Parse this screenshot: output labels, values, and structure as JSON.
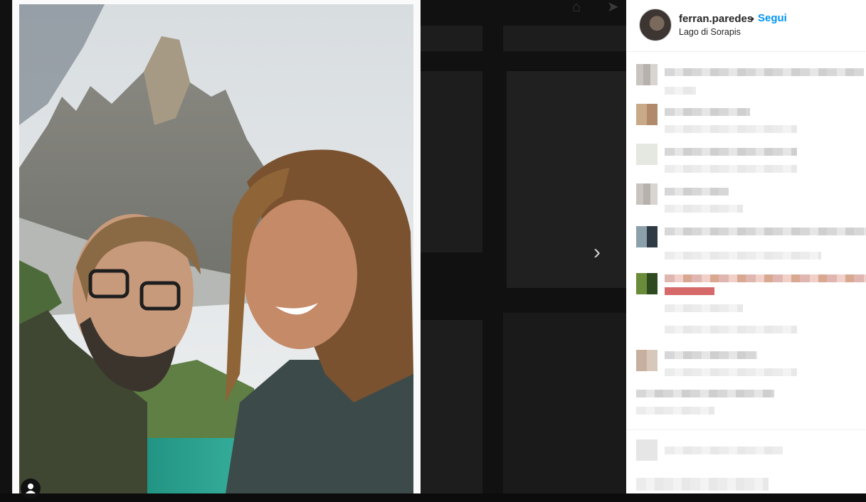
{
  "post": {
    "username": "ferran.paredes",
    "separator": "•",
    "follow_label": "Segui",
    "location": "Lago di Sorapis"
  },
  "icons": {
    "home": "home-icon",
    "explore": "compass-icon",
    "next": "chevron-right-icon",
    "tag": "user-tag-icon"
  },
  "colors": {
    "follow": "#0095f6",
    "text": "#262626",
    "backdrop": "#0c0c0c"
  }
}
